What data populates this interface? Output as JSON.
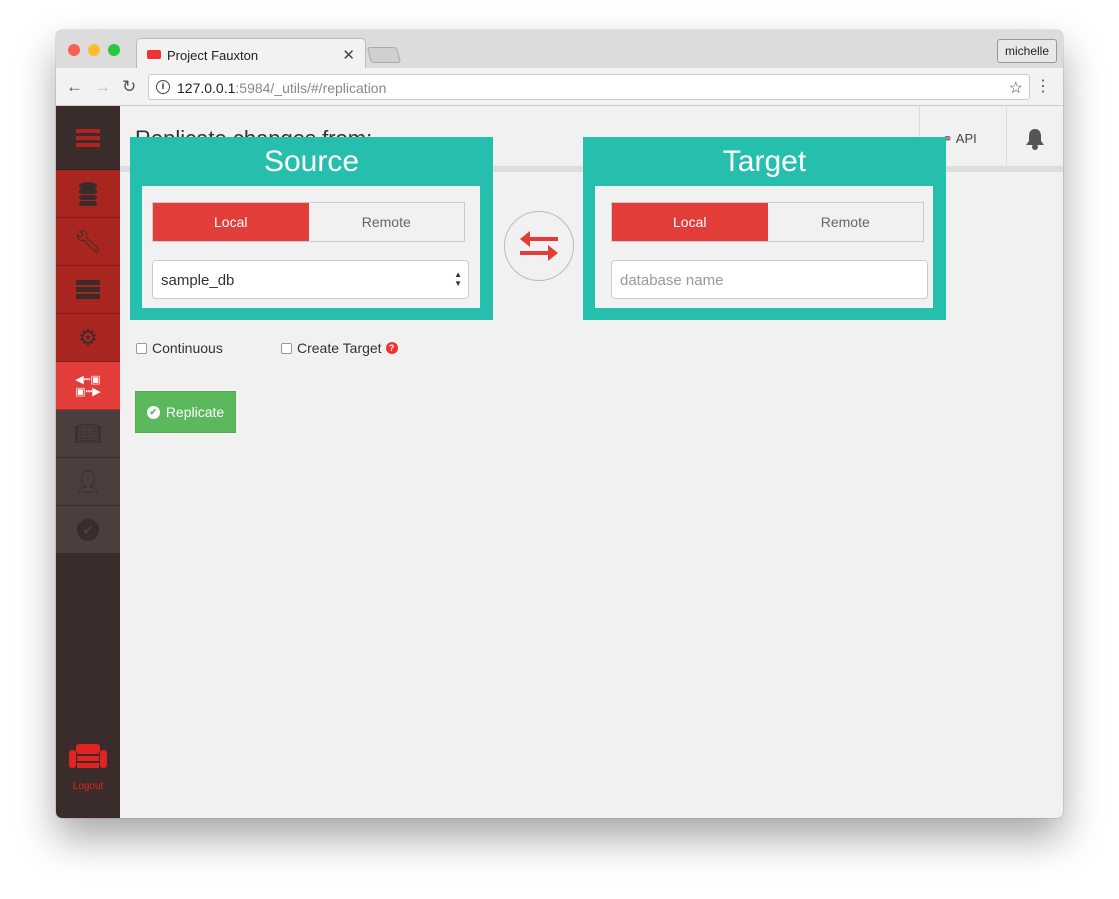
{
  "browser": {
    "tab_title": "Project Fauxton",
    "user": "michelle",
    "url_host": "127.0.0.1",
    "url_rest": ":5984/_utils/#/replication"
  },
  "header": {
    "title": "Replicate changes from:",
    "api_label": "API"
  },
  "sidebar": {
    "logout": "Logout",
    "active": "replication"
  },
  "source": {
    "title": "Source",
    "local": "Local",
    "remote": "Remote",
    "selected": "Local",
    "database": "sample_db"
  },
  "target": {
    "title": "Target",
    "local": "Local",
    "remote": "Remote",
    "selected": "Local",
    "placeholder": "database name"
  },
  "options": {
    "continuous": "Continuous",
    "create_target": "Create Target",
    "continuous_checked": false,
    "create_target_checked": false
  },
  "replicate_button": "Replicate",
  "colors": {
    "accent": "#e33d3a",
    "annotation": "#26bfad",
    "success": "#5cb85c",
    "sidebar": "#3a2c2b"
  }
}
